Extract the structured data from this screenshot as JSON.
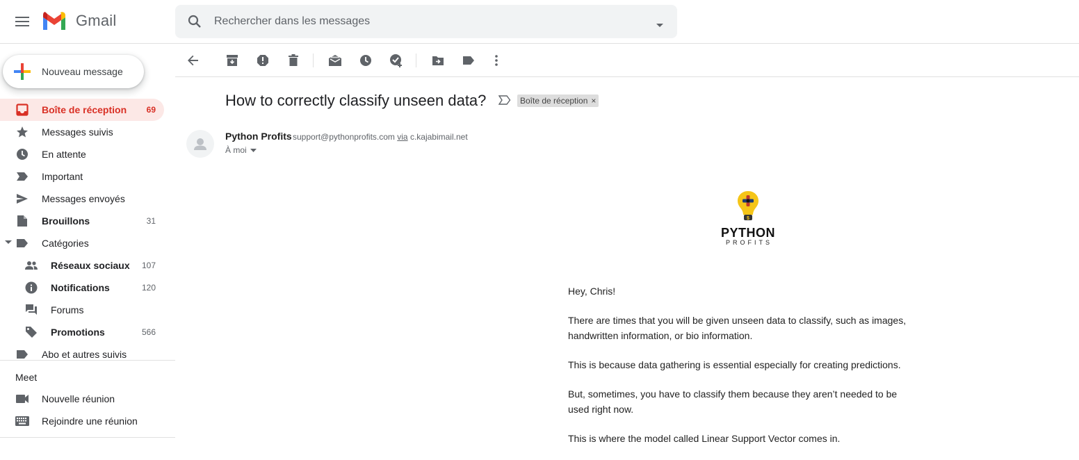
{
  "app": {
    "name": "Gmail"
  },
  "search": {
    "placeholder": "Rechercher dans les messages"
  },
  "compose": {
    "label": "Nouveau message"
  },
  "sidebar": {
    "items": [
      {
        "label": "Boîte de réception",
        "count": "69"
      },
      {
        "label": "Messages suivis",
        "count": ""
      },
      {
        "label": "En attente",
        "count": ""
      },
      {
        "label": "Important",
        "count": ""
      },
      {
        "label": "Messages envoyés",
        "count": ""
      },
      {
        "label": "Brouillons",
        "count": "31"
      },
      {
        "label": "Catégories",
        "count": ""
      },
      {
        "label": "Réseaux sociaux",
        "count": "107"
      },
      {
        "label": "Notifications",
        "count": "120"
      },
      {
        "label": "Forums",
        "count": ""
      },
      {
        "label": "Promotions",
        "count": "566"
      },
      {
        "label": "Abo et autres suivis",
        "count": ""
      }
    ]
  },
  "meet": {
    "title": "Meet",
    "items": [
      {
        "label": "Nouvelle réunion"
      },
      {
        "label": "Rejoindre une réunion"
      }
    ]
  },
  "message": {
    "subject": "How to correctly classify unseen data?",
    "label_chip": "Boîte de réception",
    "chip_close": "×",
    "sender_name": "Python Profits",
    "sender_email": "support@pythonprofits.com",
    "via_label": "via",
    "via_domain": "c.kajabimail.net",
    "to": "À moi",
    "logo_title": "PYTHON",
    "logo_sub": "PROFITS",
    "logo_dollar": "$",
    "body": [
      "Hey, Chris!",
      "There are times that you will be given unseen data to classify, such as images, handwritten information, or bio information.",
      "This is because data gathering is essential especially for creating predictions.",
      "But, sometimes, you have to classify them because they aren’t needed to be used right now.",
      "This is where the model called Linear Support Vector comes in."
    ]
  },
  "colors": {
    "accent": "#d93025",
    "active_bg": "#fce8e6",
    "icon": "#5f6368"
  }
}
